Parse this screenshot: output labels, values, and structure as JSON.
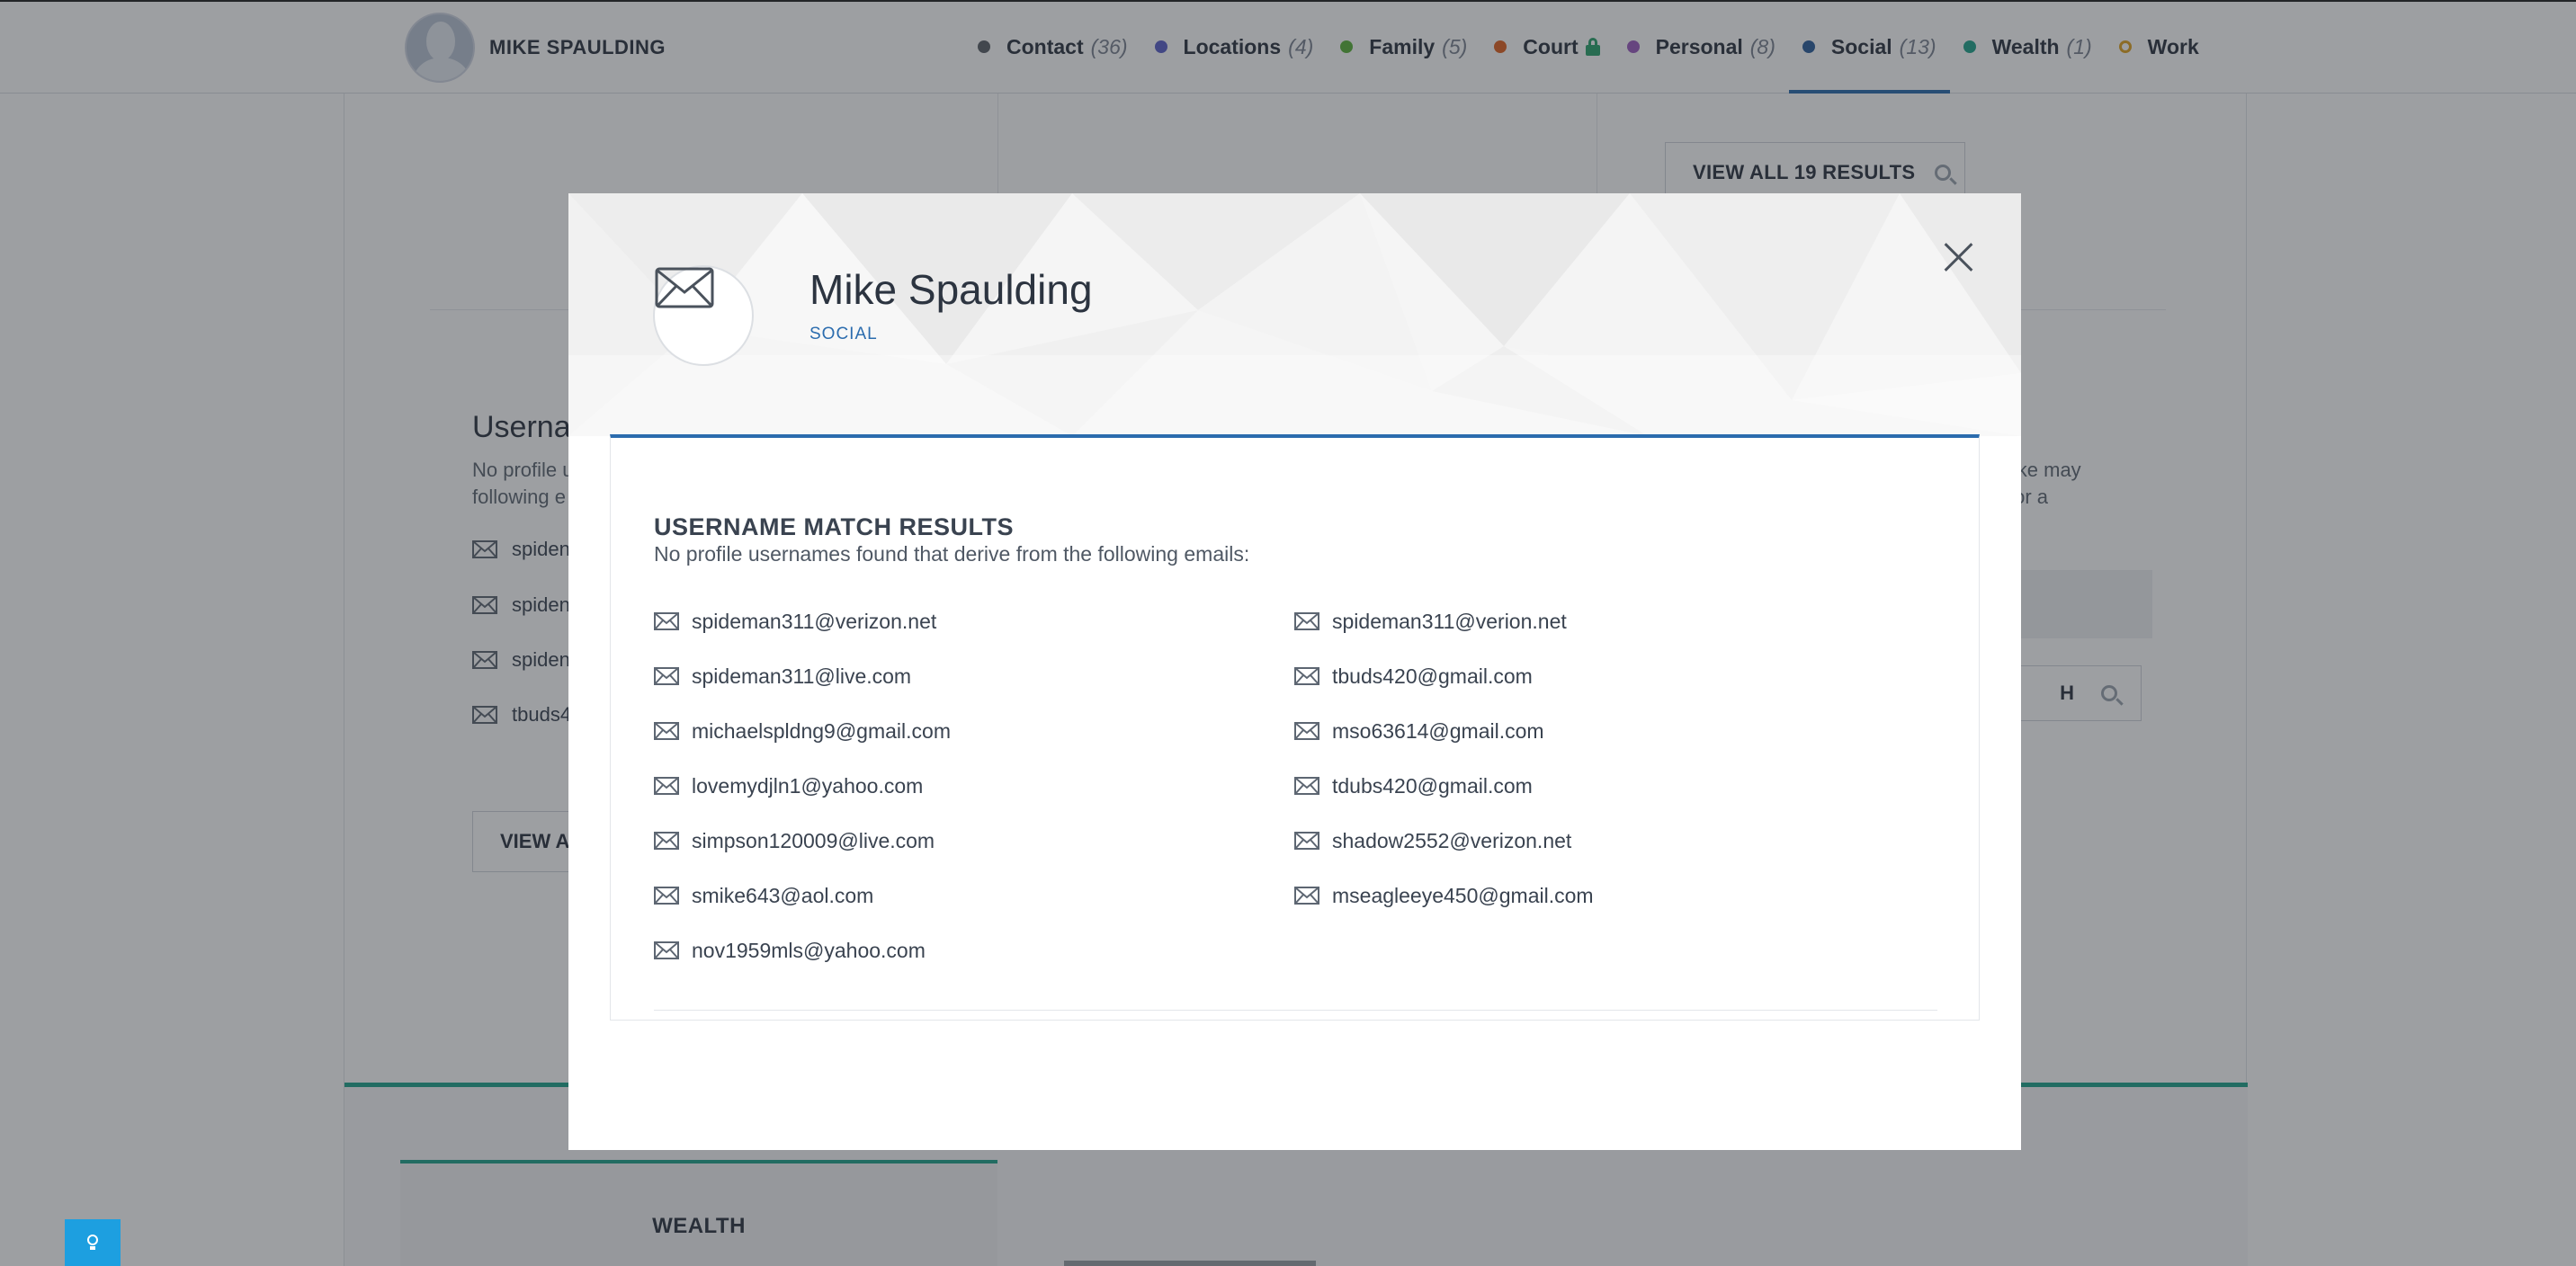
{
  "header": {
    "person_name": "MIKE SPAULDING",
    "nav": [
      {
        "label": "Contact",
        "count": "(36)",
        "color": "#5a5f66",
        "hollow": false
      },
      {
        "label": "Locations",
        "count": "(4)",
        "color": "#5a5fc8",
        "hollow": false
      },
      {
        "label": "Family",
        "count": "(5)",
        "color": "#5ab13a",
        "hollow": false
      },
      {
        "label": "Court",
        "count": "",
        "color": "#e0621f",
        "hollow": false,
        "locked": true
      },
      {
        "label": "Personal",
        "count": "(8)",
        "color": "#9b5cc0",
        "hollow": false
      },
      {
        "label": "Social",
        "count": "(13)",
        "color": "#2b5d9c",
        "hollow": false,
        "active": true
      },
      {
        "label": "Wealth",
        "count": "(1)",
        "color": "#1fa38a",
        "hollow": false
      },
      {
        "label": "Work",
        "count": "",
        "color": "#e0a21f",
        "hollow": true
      }
    ]
  },
  "background": {
    "view_all_results": "VIEW ALL 19 RESULTS",
    "section_title": "Userna",
    "desc_lines": [
      "No profile u",
      "following e"
    ],
    "rows": [
      "spiden",
      "spiden",
      "spiden",
      "tbuds4"
    ],
    "view_all_btn": "VIEW A",
    "right_desc_lines": [
      "like may",
      "for a"
    ],
    "search_btn": "H",
    "wealth_label": "WEALTH"
  },
  "modal": {
    "name": "Mike Spaulding",
    "category": "SOCIAL",
    "results_title": "USERNAME MATCH RESULTS",
    "results_subtitle": "No profile usernames found that derive from the following emails:",
    "emails_left": [
      "spideman311@verizon.net",
      "spideman311@live.com",
      "michaelspldng9@gmail.com",
      "lovemydjln1@yahoo.com",
      "simpson120009@live.com",
      "smike643@aol.com",
      "nov1959mls@yahoo.com"
    ],
    "emails_right": [
      "spideman311@verion.net",
      "tbuds420@gmail.com",
      "mso63614@gmail.com",
      "tdubs420@gmail.com",
      "shadow2552@verizon.net",
      "mseagleeye450@gmail.com"
    ]
  },
  "colors": {
    "accent_blue": "#2b6cae",
    "teal": "#1fa38a",
    "help_button": "#1d9fe0"
  },
  "icons": {
    "close": "close-icon",
    "envelope": "envelope-icon",
    "lightbulb": "lightbulb-icon",
    "search": "search-icon",
    "lock": "lock-icon"
  }
}
